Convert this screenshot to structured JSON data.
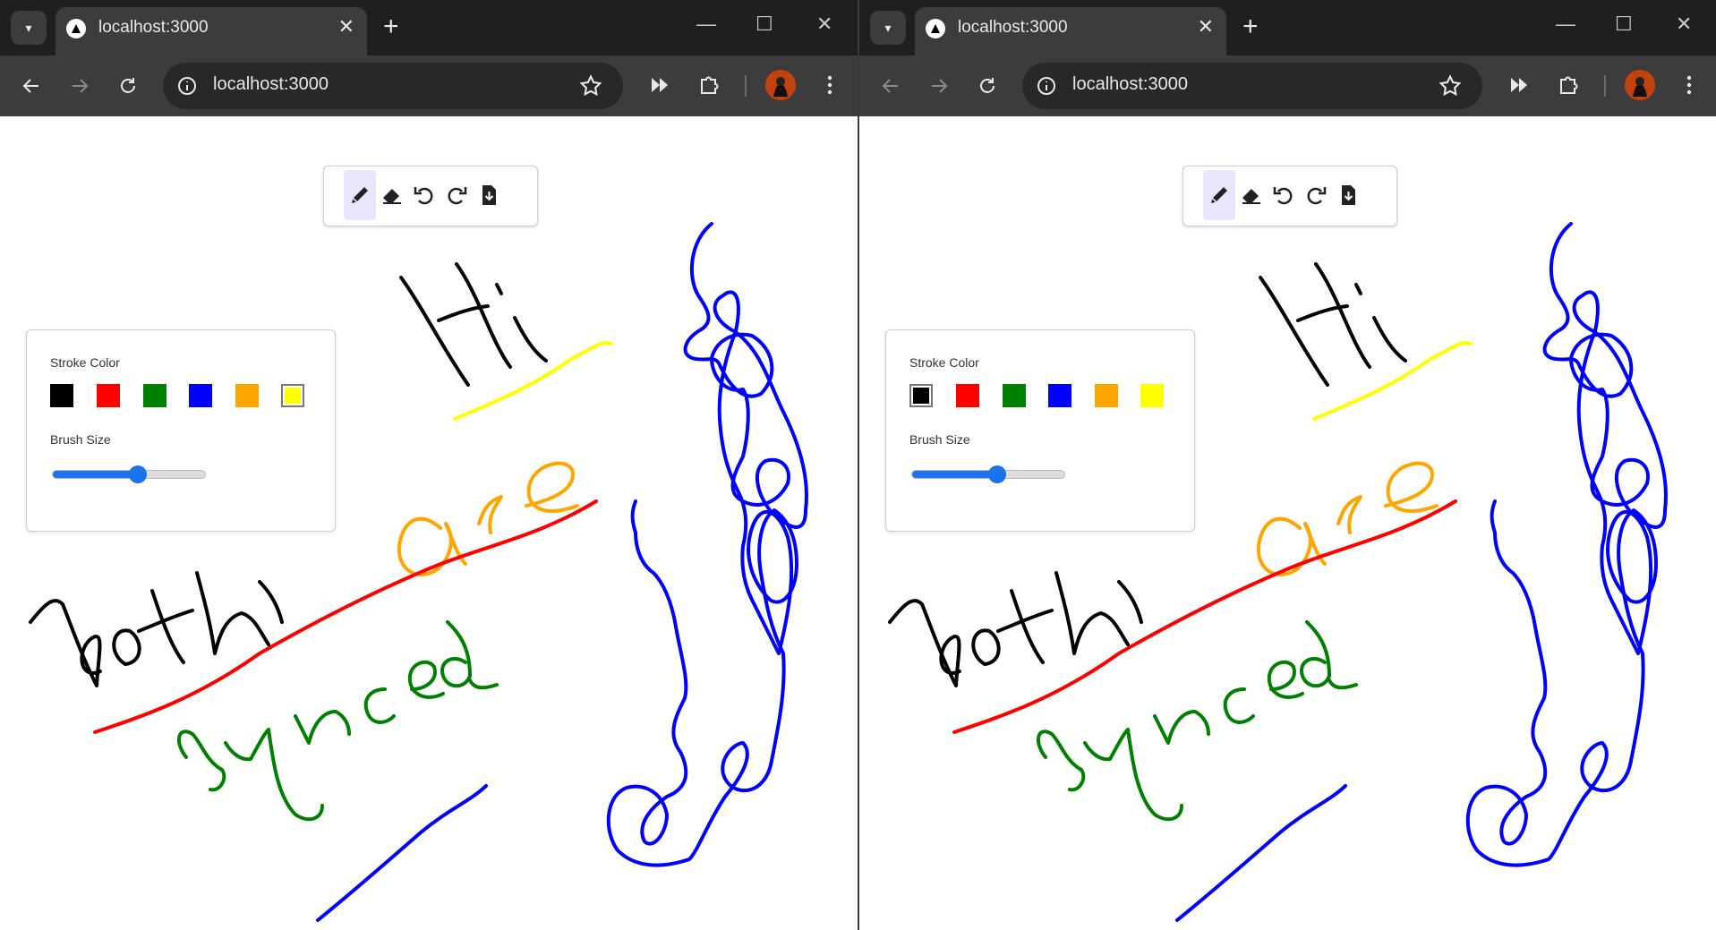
{
  "browser": {
    "tab_title": "localhost:3000",
    "url": "localhost:3000",
    "tab_close": "✕",
    "new_tab": "+"
  },
  "toolbar": {
    "tools": [
      "pencil-icon",
      "eraser-icon",
      "undo-icon",
      "redo-icon",
      "download-icon"
    ],
    "active_tool": "pencil"
  },
  "settings": {
    "stroke_color_label": "Stroke Color",
    "brush_size_label": "Brush Size",
    "colors": [
      "#000000",
      "#ff0000",
      "#008000",
      "#0000ff",
      "#ffa500",
      "#ffff00"
    ],
    "brush_size_fraction": 0.55
  },
  "windows": [
    {
      "selected_color": "#ffff00"
    },
    {
      "selected_color": "#000000"
    }
  ],
  "canvas_strokes": {
    "colors": {
      "black": "#000000",
      "red": "#ff0000",
      "green": "#008000",
      "blue": "#0000ff",
      "orange": "#ffa500",
      "yellow": "#ffff00"
    }
  }
}
